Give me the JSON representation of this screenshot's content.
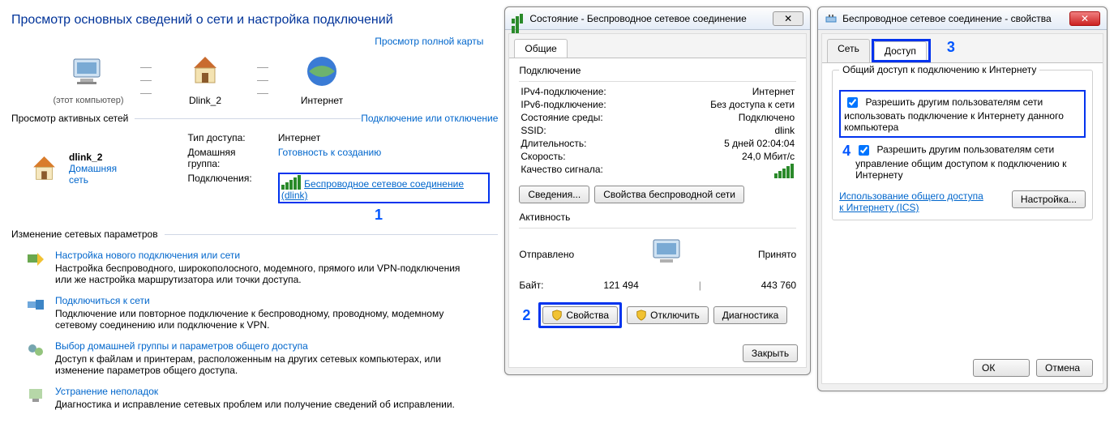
{
  "left": {
    "title": "Просмотр основных сведений о сети и настройка подключений",
    "fullmap_link": "Просмотр полной карты",
    "node1": "(этот компьютер)",
    "node2": "Dlink_2",
    "node3": "Интернет",
    "active_nets_label": "Просмотр активных сетей",
    "conn_toggle_link": "Подключение или отключение",
    "net_name": "dlink_2",
    "net_type": "Домашняя сеть",
    "access_type_lbl": "Тип доступа:",
    "access_type_val": "Интернет",
    "homegroup_lbl": "Домашняя группа:",
    "homegroup_val": "Готовность к созданию",
    "connections_lbl": "Подключения:",
    "wire_link": "Беспроводное сетевое соединение (dlink)",
    "callout1": "1",
    "change_params": "Изменение сетевых параметров",
    "task1_title": "Настройка нового подключения или сети",
    "task1_desc": "Настройка беспроводного, широкополосного, модемного, прямого или VPN-подключения или же настройка маршрутизатора или точки доступа.",
    "task2_title": "Подключиться к сети",
    "task2_desc": "Подключение или повторное подключение к беспроводному, проводному, модемному сетевому соединению или подключение к VPN.",
    "task3_title": "Выбор домашней группы и параметров общего доступа",
    "task3_desc": "Доступ к файлам и принтерам, расположенным на других сетевых компьютерах, или изменение параметров общего доступа.",
    "task4_title": "Устранение неполадок",
    "task4_desc": "Диагностика и исправление сетевых проблем или получение сведений об исправлении."
  },
  "dlgStatus": {
    "title": "Состояние - Беспроводное сетевое соединение",
    "tab_general": "Общие",
    "grp_conn": "Подключение",
    "ipv4_lbl": "IPv4-подключение:",
    "ipv4_val": "Интернет",
    "ipv6_lbl": "IPv6-подключение:",
    "ipv6_val": "Без доступа к сети",
    "media_lbl": "Состояние среды:",
    "media_val": "Подключено",
    "ssid_lbl": "SSID:",
    "ssid_val": "dlink",
    "duration_lbl": "Длительность:",
    "duration_val": "5 дней 02:04:04",
    "speed_lbl": "Скорость:",
    "speed_val": "24,0 Мбит/с",
    "signal_lbl": "Качество сигнала:",
    "details_btn": "Сведения...",
    "wprops_btn": "Свойства беспроводной сети",
    "activity_title": "Активность",
    "sent_lbl": "Отправлено",
    "recv_lbl": "Принято",
    "bytes_lbl": "Байт:",
    "bytes_sent": "121 494",
    "bytes_recv": "443 760",
    "callout2": "2",
    "props_btn": "Свойства",
    "disable_btn": "Отключить",
    "diag_btn": "Диагностика",
    "close_btn": "Закрыть"
  },
  "dlgProps": {
    "title": "Беспроводное сетевое соединение - свойства",
    "tab_net": "Сеть",
    "tab_access": "Доступ",
    "callout3": "3",
    "group_title": "Общий доступ к подключению к Интернету",
    "chk1": "Разрешить другим пользователям сети использовать подключение к Интернету данного компьютера",
    "callout4": "4",
    "chk2": "Разрешить другим пользователям сети управление общим доступом к подключению к Интернету",
    "ics_link": "Использование общего доступа к Интернету (ICS)",
    "settings_btn": "Настройка...",
    "ok": "ОК",
    "cancel": "Отмена"
  }
}
